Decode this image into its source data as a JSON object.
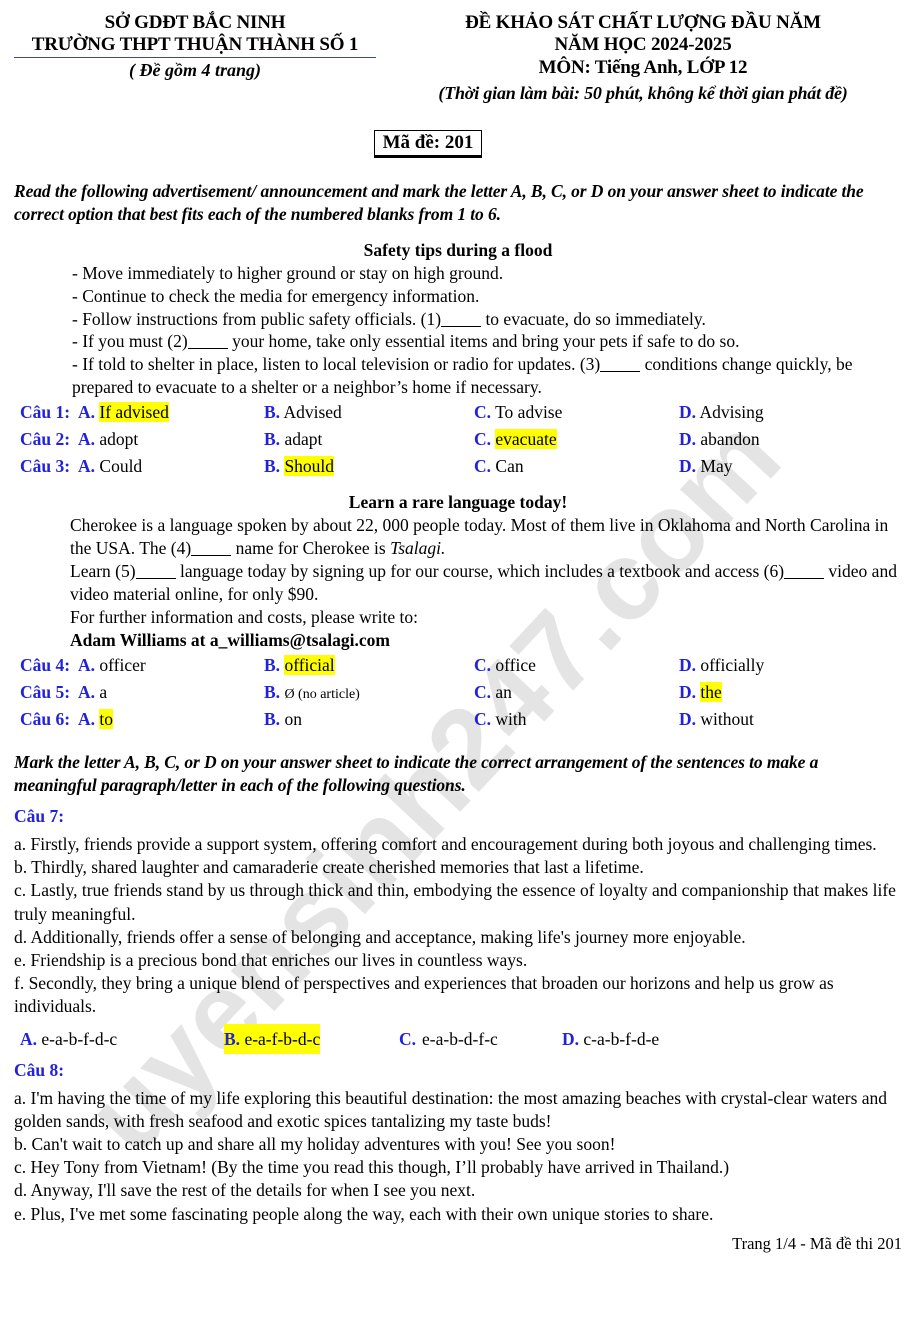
{
  "header": {
    "dept": "SỞ GDĐT BẮC NINH",
    "school": "TRƯỜNG THPT THUẬN THÀNH SỐ 1",
    "pages_note": "( Đề gồm 4 trang)",
    "exam_title": "ĐỀ  KHẢO SÁT CHẤT LƯỢNG ĐẦU NĂM",
    "school_year": "NĂM HỌC 2024-2025",
    "subject": "MÔN: Tiếng Anh, LỚP 12",
    "duration": "(Thời gian làm bài: 50 phút, không kể thời gian phát đề)",
    "exam_code": "Mã đề: 201"
  },
  "watermark": {
    "text": "uyensinh247.com"
  },
  "instruction_1": "Read the following advertisement/ announcement and mark the letter A, B, C, or D on your answer sheet to indicate the correct option that best fits each of the numbered blanks from 1 to 6.",
  "passage_1": {
    "title": "Safety tips during a flood",
    "lines": [
      "- Move immediately to higher ground or stay on high ground.",
      "- Continue to check the media for emergency information."
    ],
    "line3_a": "- Follow instructions from public safety officials. (1)",
    "line3_b": " to evacuate, do so immediately.",
    "line4_a": "- If you must (2)",
    "line4_b": " your home, take only essential items and bring your pets if safe to do so.",
    "line5_a": "- If told to shelter in place, listen to local television or radio for updates. (3)",
    "line5_b": " conditions change quickly, be prepared to evacuate to a shelter or a neighbor’s home if necessary."
  },
  "questions_1_3": [
    {
      "label": "Câu 1:",
      "options": [
        {
          "letter": "A.",
          "text": "If advised",
          "highlight": true
        },
        {
          "letter": "B.",
          "text": "Advised",
          "highlight": false
        },
        {
          "letter": "C.",
          "text": "To advise",
          "highlight": false
        },
        {
          "letter": "D.",
          "text": "Advising",
          "highlight": false
        }
      ]
    },
    {
      "label": "Câu 2:",
      "options": [
        {
          "letter": "A.",
          "text": "adopt",
          "highlight": false
        },
        {
          "letter": "B.",
          "text": "adapt",
          "highlight": false
        },
        {
          "letter": "C.",
          "text": "evacuate",
          "highlight": true
        },
        {
          "letter": "D.",
          "text": "abandon",
          "highlight": false
        }
      ]
    },
    {
      "label": "Câu 3:",
      "options": [
        {
          "letter": "A.",
          "text": "Could",
          "highlight": false
        },
        {
          "letter": "B.",
          "text": "Should",
          "highlight": true
        },
        {
          "letter": "C.",
          "text": "Can",
          "highlight": false
        },
        {
          "letter": "D.",
          "text": "May",
          "highlight": false
        }
      ]
    }
  ],
  "passage_2": {
    "title": "Learn a rare language today!",
    "line1": "Cherokee is a language spoken by about 22, 000 people today. Most of them live in Oklahoma and North Carolina in the USA. The (4)",
    "line1_b": " name for Cherokee is ",
    "line1_italic": "Tsalagi.",
    "line2_a": "Learn (5)",
    "line2_b": " language today by signing up for our course, which includes a textbook and access (6)",
    "line2_c": " video and video material online, for only $90.",
    "line3": "For further information and costs, please write to:",
    "contact": "Adam Williams at a_williams@tsalagi.com"
  },
  "questions_4_6": [
    {
      "label": "Câu 4:",
      "options": [
        {
          "letter": "A.",
          "text": "officer",
          "highlight": false
        },
        {
          "letter": "B.",
          "text": "official",
          "highlight": true
        },
        {
          "letter": "C.",
          "text": "office",
          "highlight": false
        },
        {
          "letter": "D.",
          "text": "officially",
          "highlight": false
        }
      ]
    },
    {
      "label": "Câu 5:",
      "options": [
        {
          "letter": "A.",
          "text": "a",
          "highlight": false
        },
        {
          "letter": "B.",
          "text": "Ø (no article)",
          "highlight": false
        },
        {
          "letter": "C.",
          "text": "an",
          "highlight": false
        },
        {
          "letter": "D.",
          "text": "the",
          "highlight": true
        }
      ]
    },
    {
      "label": "Câu 6:",
      "options": [
        {
          "letter": "A.",
          "text": "to",
          "highlight": true
        },
        {
          "letter": "B.",
          "text": "on",
          "highlight": false
        },
        {
          "letter": "C.",
          "text": "with",
          "highlight": false
        },
        {
          "letter": "D.",
          "text": "without",
          "highlight": false
        }
      ]
    }
  ],
  "instruction_2": "Mark the letter A, B, C, or D on your answer sheet to indicate the correct arrangement of the sentences to make a meaningful paragraph/letter in each of the following questions.",
  "question_7": {
    "label": "Câu 7:",
    "sentences": [
      "a. Firstly, friends provide a support system, offering comfort and encouragement during both joyous and challenging times.",
      "b. Thirdly, shared laughter and camaraderie create cherished memories that last a lifetime.",
      "c. Lastly, true friends stand by us through thick and thin, embodying the essence of loyalty and companionship that makes life truly meaningful.",
      "d. Additionally, friends offer a sense of belonging and acceptance, making life's journey more enjoyable.",
      "e. Friendship is a precious bond that enriches our lives in countless ways.",
      "f. Secondly, they bring a unique blend of perspectives and experiences that broaden our horizons and help us grow as individuals."
    ],
    "options": [
      {
        "letter": "A.",
        "text": "e-a-b-f-d-c",
        "highlight": false
      },
      {
        "letter": "B.",
        "text": "e-a-f-b-d-c",
        "highlight": true
      },
      {
        "letter": "C.",
        "text": "e-a-b-d-f-c",
        "highlight": false
      },
      {
        "letter": "D.",
        "text": "c-a-b-f-d-e",
        "highlight": false
      }
    ]
  },
  "question_8": {
    "label": "Câu 8:",
    "sentences": [
      "a. I'm having the time of my life exploring this beautiful destination: the most amazing beaches with crystal-clear waters and golden sands, with fresh seafood and exotic spices tantalizing my taste buds!",
      "b. Can't wait to catch up and share all my holiday adventures with you! See you soon!",
      "c. Hey Tony from Vietnam! (By the time you read this though, I’ll probably have arrived in Thailand.)",
      "d. Anyway, I'll save the rest of the details for when I see you next.",
      "e. Plus, I've met some fascinating people along the way, each with their own unique stories to share."
    ]
  },
  "footer": "Trang 1/4 - Mã đề thi 201",
  "colors": {
    "label_blue": "#2222dd",
    "highlight_yellow": "#ffff00",
    "underline_blue": "#3b4a8a"
  }
}
